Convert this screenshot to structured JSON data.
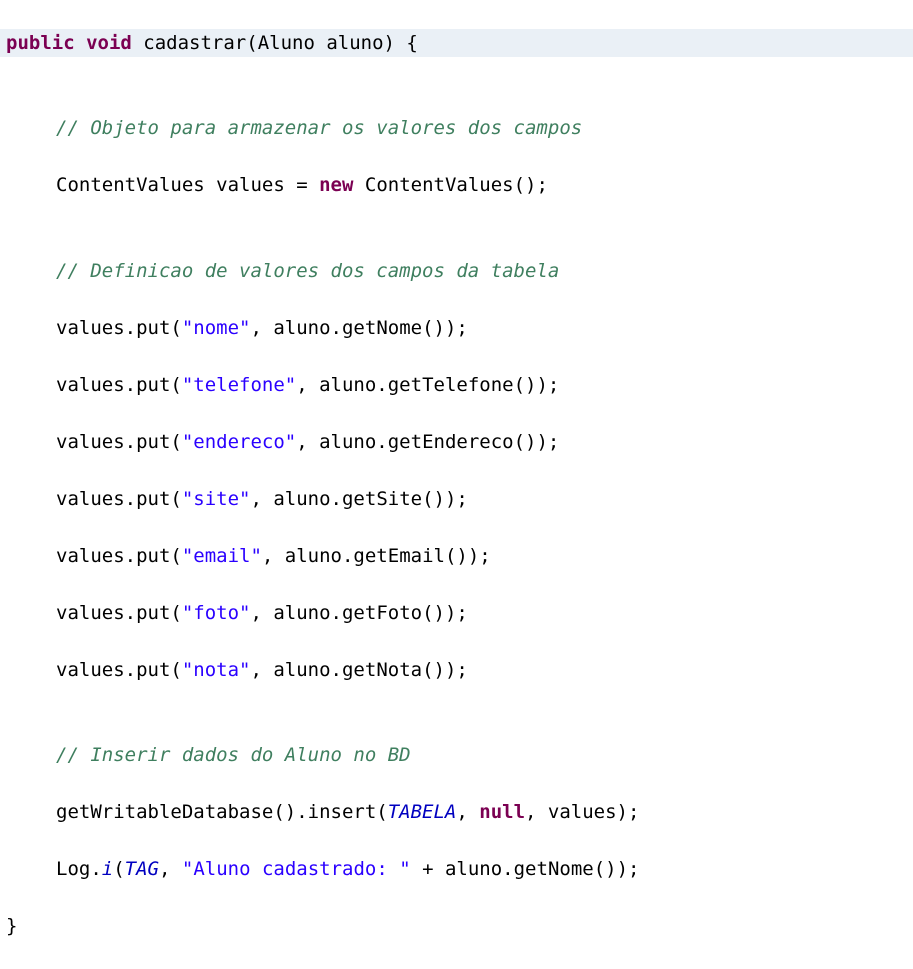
{
  "code": {
    "line1": {
      "kw_public": "public",
      "kw_void": "void",
      "method": " cadastrar(Aluno aluno) {"
    },
    "line2": "",
    "line3_comment": "// Objeto para armazenar os valores dos campos",
    "line4": {
      "prefix": "ContentValues values = ",
      "kw_new": "new",
      "suffix": " ContentValues();"
    },
    "line5": "",
    "line6_comment": "// Definicao de valores dos campos da tabela",
    "line7": {
      "prefix": "values.put(",
      "str": "\"nome\"",
      "suffix": ", aluno.getNome());"
    },
    "line8": {
      "prefix": "values.put(",
      "str": "\"telefone\"",
      "suffix": ", aluno.getTelefone());"
    },
    "line9": {
      "prefix": "values.put(",
      "str": "\"endereco\"",
      "suffix": ", aluno.getEndereco());"
    },
    "line10": {
      "prefix": "values.put(",
      "str": "\"site\"",
      "suffix": ", aluno.getSite());"
    },
    "line11": {
      "prefix": "values.put(",
      "str": "\"email\"",
      "suffix": ", aluno.getEmail());"
    },
    "line12": {
      "prefix": "values.put(",
      "str": "\"foto\"",
      "suffix": ", aluno.getFoto());"
    },
    "line13": {
      "prefix": "values.put(",
      "str": "\"nota\"",
      "suffix": ", aluno.getNota());"
    },
    "line14": "",
    "line15_comment": "// Inserir dados do Aluno no BD",
    "line16": {
      "prefix": "getWritableDatabase().insert(",
      "static1": "TABELA",
      "mid": ", ",
      "kw_null": "null",
      "suffix": ", values);"
    },
    "line17": {
      "prefix": "Log.",
      "static_i": "i",
      "open": "(",
      "static_tag": "TAG",
      "mid": ", ",
      "str": "\"Aluno cadastrado: \"",
      "suffix": " + aluno.getNome());"
    },
    "line18": "}"
  }
}
